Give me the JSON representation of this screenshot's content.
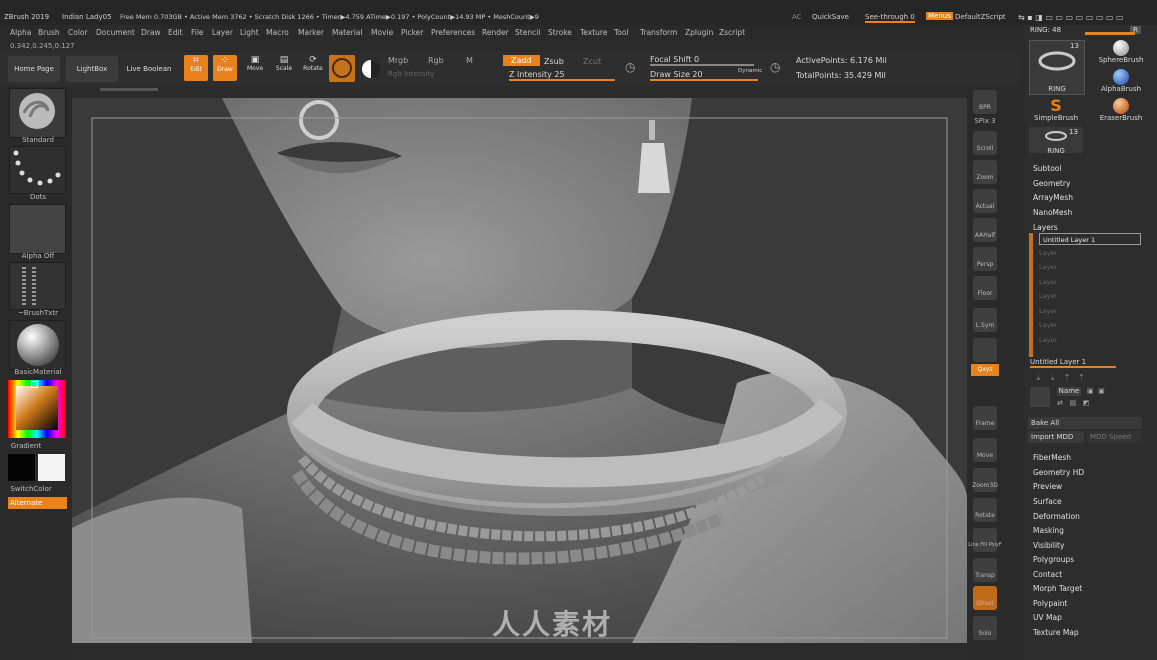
{
  "title_bar": {
    "app": "ZBrush 2019",
    "document": "Indian Lady05",
    "stats": "Free Mem 0.703GB • Active Mem 3762 • Scratch Disk 1266 • Timer▶4.759 ATime▶0.197 • PolyCount▶14.93 MP • MeshCount▶9",
    "ac": "AC",
    "quicksave": "QuickSave",
    "see_through": "See-through  0",
    "menus": "Menus",
    "default_zscript": "DefaultZScript"
  },
  "menu": [
    "Alpha",
    "Brush",
    "Color",
    "Document",
    "Draw",
    "Edit",
    "File",
    "Layer",
    "Light",
    "Macro",
    "Marker",
    "Material",
    "Movie",
    "Picker",
    "Preferences",
    "Render",
    "Stencil",
    "Stroke",
    "Texture",
    "Tool",
    "Transform",
    "Zplugin",
    "Zscript"
  ],
  "coords": "0.342,0.245,0.127",
  "toolbar": {
    "home": "Home Page",
    "lightbox": "LightBox",
    "live_boolean": "Live Boolean",
    "edit": "Edit",
    "draw": "Draw",
    "move": "Move",
    "scale": "Scale",
    "rotate": "Rotate",
    "mrgb": "Mrgb",
    "rgb": "Rgb",
    "m": "M",
    "rgb_intensity": "Rgb Intensity",
    "zadd": "Zadd",
    "zsub": "Zsub",
    "zcut": "Zcut",
    "z_intensity": "Z Intensity 25",
    "focal_shift": "Focal Shift 0",
    "draw_size": "Draw Size 20",
    "dynamic": "Dynamic",
    "active_points": "ActivePoints: 6.176 Mil",
    "total_points": "TotalPoints: 35.429 Mil"
  },
  "left_shelf": {
    "standard": "Standard",
    "dots": "Dots",
    "alpha_off": "Alpha Off",
    "brush_txtr": "~BrushTxtr",
    "material": "BasicMaterial",
    "gradient": "Gradient",
    "switch_color": "SwitchColor",
    "alternate": "Alternate"
  },
  "right_shelf": [
    "BPR",
    "SPix 3",
    "Scroll",
    "Zoom",
    "Actual",
    "AAHalf",
    "Persp",
    "Floor",
    "L.Sym",
    "",
    "Qxyz",
    "",
    "",
    "Frame",
    "Move",
    "Zoom3D",
    "Rotate",
    "Line Fill PolyF",
    "Transp",
    "Ghost",
    "Solo"
  ],
  "panel": {
    "ring_label": "RING: 48",
    "r_badge": "R",
    "brushes": [
      {
        "name": "RING",
        "count": "13"
      },
      {
        "name": "SphereBrush"
      },
      {
        "name": "AlphaBrush"
      },
      {
        "name": "SimpleBrush"
      },
      {
        "name": "EraserBrush"
      },
      {
        "name": "RING",
        "count": "13"
      }
    ],
    "top_items": [
      "Subtool",
      "Geometry",
      "ArrayMesh",
      "NanoMesh"
    ],
    "layers_title": "Layers",
    "layer_name": "Untitled Layer 1",
    "empty_layer": "Layer",
    "layer_slider": "Untitled Layer 1",
    "name_btn": "Name",
    "bake_all": "Bake All",
    "import_mdd": "Import MDD",
    "mdd_speed": "MDD Speed",
    "bottom_items": [
      "FiberMesh",
      "Geometry HD",
      "Preview",
      "Surface",
      "Deformation",
      "Masking",
      "Visibility",
      "Polygroups",
      "Contact",
      "Morph Target",
      "Polypaint",
      "UV Map",
      "Texture Map"
    ]
  },
  "watermark": "人人素材",
  "colors": {
    "accent": "#e8821c",
    "bg": "#2b2b2b"
  }
}
